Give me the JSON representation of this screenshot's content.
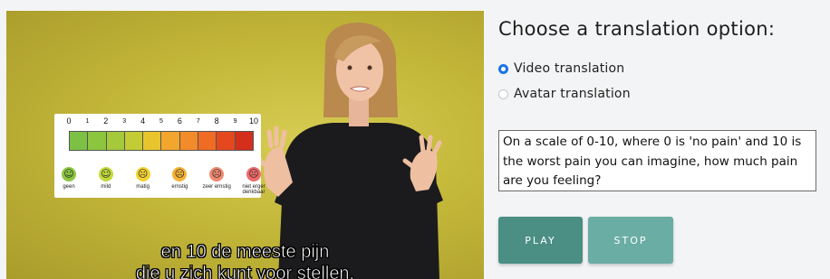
{
  "video": {
    "subtitle_line1": "en 10 de meeste pijn",
    "subtitle_line2": "die u zich kunt voor stellen.",
    "pain_scale": {
      "ticks": [
        "0",
        "1",
        "2",
        "3",
        "4",
        "5",
        "6",
        "7",
        "8",
        "9",
        "10"
      ],
      "segment_colors": [
        "#7cc144",
        "#8cc63f",
        "#a5c93a",
        "#c3cc35",
        "#e8c52c",
        "#f2a62e",
        "#f28b2a",
        "#f06b24",
        "#e5471f",
        "#d42e1c"
      ],
      "faces": [
        {
          "label": "geen",
          "color": "#8cc63f",
          "glyph": "☺"
        },
        {
          "label": "mild",
          "color": "#c3d93b",
          "glyph": "☺"
        },
        {
          "label": "matig",
          "color": "#f2d233",
          "glyph": "☹"
        },
        {
          "label": "ernstig",
          "color": "#f5b335",
          "glyph": "☹"
        },
        {
          "label": "zeer ernstig",
          "color": "#f08a70",
          "glyph": "☹"
        },
        {
          "label": "niet erger denkbaar",
          "color": "#ee6a6a",
          "glyph": "☹"
        }
      ]
    }
  },
  "panel": {
    "heading": "Choose a translation option:",
    "options": [
      {
        "label": "Video translation",
        "selected": true
      },
      {
        "label": "Avatar translation",
        "selected": false
      }
    ],
    "question": "On a scale of 0-10, where 0 is 'no pain' and 10 is the worst pain you can imagine, how much pain are you feeling?",
    "play_label": "PLAY",
    "stop_label": "STOP"
  },
  "colors": {
    "accent_play": "#4a8e84",
    "accent_stop": "#6aada4",
    "radio_selected": "#1a73e8",
    "video_background": "#c4b83a"
  }
}
